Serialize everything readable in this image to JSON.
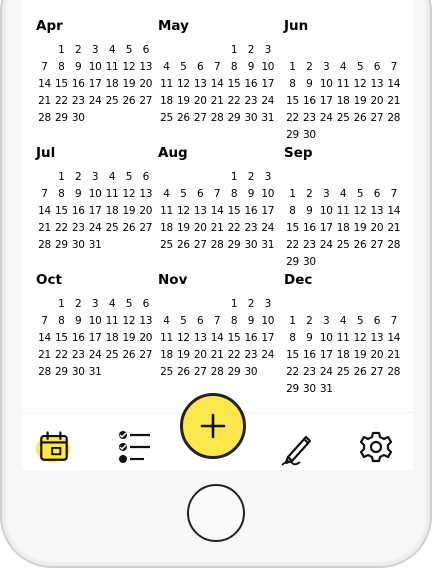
{
  "months": [
    {
      "name": "Apr",
      "days": [
        "",
        "1",
        "2",
        "3",
        "4",
        "5",
        "6",
        "7",
        "8",
        "9",
        "10",
        "11",
        "12",
        "13",
        "14",
        "15",
        "16",
        "17",
        "18",
        "19",
        "20",
        "21",
        "22",
        "23",
        "24",
        "25",
        "26",
        "27",
        "28",
        "29",
        "30"
      ]
    },
    {
      "name": "May",
      "days": [
        "",
        "",
        "",
        "",
        "1",
        "2",
        "3",
        "4",
        "5",
        "6",
        "7",
        "8",
        "9",
        "10",
        "11",
        "12",
        "13",
        "14",
        "15",
        "16",
        "17",
        "18",
        "19",
        "20",
        "21",
        "22",
        "23",
        "24",
        "25",
        "26",
        "27",
        "28",
        "29",
        "30",
        "31"
      ]
    },
    {
      "name": "Jun",
      "days": [
        "",
        "",
        "",
        "",
        "",
        "",
        "",
        "1",
        "2",
        "3",
        "4",
        "5",
        "6",
        "7",
        "8",
        "9",
        "10",
        "11",
        "12",
        "13",
        "14",
        "15",
        "16",
        "17",
        "18",
        "19",
        "20",
        "21",
        "22",
        "23",
        "24",
        "25",
        "26",
        "27",
        "28",
        "29",
        "30"
      ]
    },
    {
      "name": "Jul",
      "days": [
        "",
        "1",
        "2",
        "3",
        "4",
        "5",
        "6",
        "7",
        "8",
        "9",
        "10",
        "11",
        "12",
        "13",
        "14",
        "15",
        "16",
        "17",
        "18",
        "19",
        "20",
        "21",
        "22",
        "23",
        "24",
        "25",
        "26",
        "27",
        "28",
        "29",
        "30",
        "31"
      ]
    },
    {
      "name": "Aug",
      "days": [
        "",
        "",
        "",
        "",
        "1",
        "2",
        "3",
        "4",
        "5",
        "6",
        "7",
        "8",
        "9",
        "10",
        "11",
        "12",
        "13",
        "14",
        "15",
        "16",
        "17",
        "18",
        "19",
        "20",
        "21",
        "22",
        "23",
        "24",
        "25",
        "26",
        "27",
        "28",
        "29",
        "30",
        "31"
      ]
    },
    {
      "name": "Sep",
      "days": [
        "",
        "",
        "",
        "",
        "",
        "",
        "",
        "1",
        "2",
        "3",
        "4",
        "5",
        "6",
        "7",
        "8",
        "9",
        "10",
        "11",
        "12",
        "13",
        "14",
        "15",
        "16",
        "17",
        "18",
        "19",
        "20",
        "21",
        "22",
        "23",
        "24",
        "25",
        "26",
        "27",
        "28",
        "29",
        "30"
      ]
    },
    {
      "name": "Oct",
      "days": [
        "",
        "1",
        "2",
        "3",
        "4",
        "5",
        "6",
        "7",
        "8",
        "9",
        "10",
        "11",
        "12",
        "13",
        "14",
        "15",
        "16",
        "17",
        "18",
        "19",
        "20",
        "21",
        "22",
        "23",
        "24",
        "25",
        "26",
        "27",
        "28",
        "29",
        "30",
        "31"
      ]
    },
    {
      "name": "Nov",
      "days": [
        "",
        "",
        "",
        "",
        "1",
        "2",
        "3",
        "4",
        "5",
        "6",
        "7",
        "8",
        "9",
        "10",
        "11",
        "12",
        "13",
        "14",
        "15",
        "16",
        "17",
        "18",
        "19",
        "20",
        "21",
        "22",
        "23",
        "24",
        "25",
        "26",
        "27",
        "28",
        "29",
        "30"
      ]
    },
    {
      "name": "Dec",
      "days": [
        "",
        "",
        "",
        "",
        "",
        "",
        "",
        "1",
        "2",
        "3",
        "4",
        "5",
        "6",
        "7",
        "8",
        "9",
        "10",
        "11",
        "12",
        "13",
        "14",
        "15",
        "16",
        "17",
        "18",
        "19",
        "20",
        "21",
        "22",
        "23",
        "24",
        "25",
        "26",
        "27",
        "28",
        "29",
        "30",
        "31"
      ]
    }
  ],
  "tabs": [
    {
      "icon": "calendar-icon",
      "active": true
    },
    {
      "icon": "checklist-icon",
      "active": false
    },
    {
      "icon": "plus-icon",
      "active": false
    },
    {
      "icon": "pen-icon",
      "active": false
    },
    {
      "icon": "gear-icon",
      "active": false
    }
  ],
  "colors": {
    "accent": "#fde74c",
    "ink": "#111111"
  }
}
